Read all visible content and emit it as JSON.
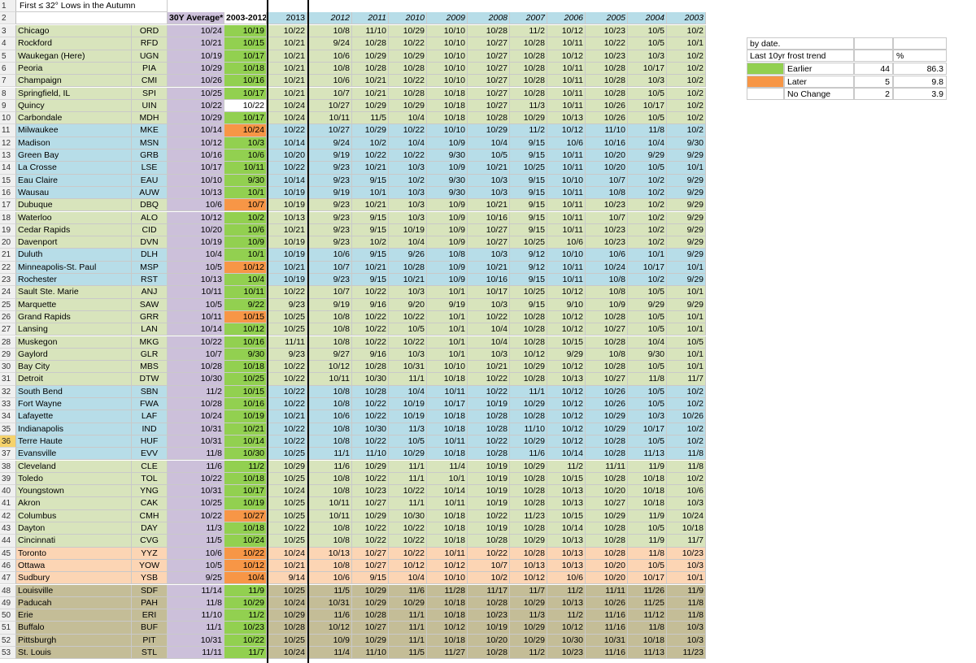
{
  "sheet_title": "First ≤ 32° Lows in the Autumn",
  "headers": {
    "avg30": "30Y Average*",
    "avg10": "2003-2012",
    "years": [
      "2013",
      "2012",
      "2011",
      "2010",
      "2009",
      "2008",
      "2007",
      "2006",
      "2005",
      "2004",
      "2003"
    ]
  },
  "colors": {
    "group_green": "#d8e4bc",
    "group_blue": "#b7dde8",
    "group_peach": "#fcd5b4",
    "group_tan": "#c4bd97",
    "avg30_purple": "#ccc0da",
    "earlier_green": "#92d050",
    "later_orange": "#f79646",
    "header_blue": "#b7dde8"
  },
  "legend": {
    "by_date": "by date.",
    "trend_label": "Last 10yr frost trend",
    "pct_header": "%",
    "rows": [
      {
        "label": "Earlier",
        "count": "44",
        "pct": "86.3",
        "color": "#92d050"
      },
      {
        "label": "Later",
        "count": "5",
        "pct": "9.8",
        "color": "#f79646"
      },
      {
        "label": "No Change",
        "count": "2",
        "pct": "3.9",
        "color": "#ffffff"
      }
    ]
  },
  "rows": [
    {
      "n": "3",
      "city": "Chicago",
      "code": "ORD",
      "a30": "10/24",
      "a10": "10/19",
      "t": "e",
      "y": [
        "10/22",
        "10/8",
        "11/10",
        "10/29",
        "10/10",
        "10/28",
        "11/2",
        "10/12",
        "10/23",
        "10/5",
        "10/2"
      ],
      "g": "green"
    },
    {
      "n": "4",
      "city": "Rockford",
      "code": "RFD",
      "a30": "10/21",
      "a10": "10/15",
      "t": "e",
      "y": [
        "10/21",
        "9/24",
        "10/28",
        "10/22",
        "10/10",
        "10/27",
        "10/28",
        "10/11",
        "10/22",
        "10/5",
        "10/1"
      ],
      "g": "green"
    },
    {
      "n": "5",
      "city": "Waukegan (Here)",
      "code": "UGN",
      "a30": "10/19",
      "a10": "10/17",
      "t": "e",
      "y": [
        "10/21",
        "10/6",
        "10/29",
        "10/29",
        "10/10",
        "10/27",
        "10/28",
        "10/12",
        "10/23",
        "10/3",
        "10/2"
      ],
      "g": "green"
    },
    {
      "n": "6",
      "city": "Peoria",
      "code": "PIA",
      "a30": "10/29",
      "a10": "10/18",
      "t": "e",
      "y": [
        "10/21",
        "10/8",
        "10/28",
        "10/28",
        "10/10",
        "10/27",
        "10/28",
        "10/11",
        "10/28",
        "10/17",
        "10/2"
      ],
      "g": "green"
    },
    {
      "n": "7",
      "city": "Champaign",
      "code": "CMI",
      "a30": "10/26",
      "a10": "10/16",
      "t": "e",
      "y": [
        "10/21",
        "10/6",
        "10/21",
        "10/22",
        "10/10",
        "10/27",
        "10/28",
        "10/11",
        "10/28",
        "10/3",
        "10/2"
      ],
      "g": "green"
    },
    {
      "n": "8",
      "city": "Springfield, IL",
      "code": "SPI",
      "a30": "10/25",
      "a10": "10/17",
      "t": "e",
      "y": [
        "10/21",
        "10/7",
        "10/21",
        "10/28",
        "10/18",
        "10/27",
        "10/28",
        "10/11",
        "10/28",
        "10/5",
        "10/2"
      ],
      "g": "green"
    },
    {
      "n": "9",
      "city": "Quincy",
      "code": "UIN",
      "a30": "10/22",
      "a10": "10/22",
      "t": "n",
      "y": [
        "10/24",
        "10/27",
        "10/29",
        "10/29",
        "10/18",
        "10/27",
        "11/3",
        "10/11",
        "10/26",
        "10/17",
        "10/2"
      ],
      "g": "green"
    },
    {
      "n": "10",
      "city": "Carbondale",
      "code": "MDH",
      "a30": "10/29",
      "a10": "10/17",
      "t": "e",
      "y": [
        "10/24",
        "10/11",
        "11/5",
        "10/4",
        "10/18",
        "10/28",
        "10/29",
        "10/13",
        "10/26",
        "10/5",
        "10/2"
      ],
      "g": "green"
    },
    {
      "n": "11",
      "city": "Milwaukee",
      "code": "MKE",
      "a30": "10/14",
      "a10": "10/24",
      "t": "l",
      "y": [
        "10/22",
        "10/27",
        "10/29",
        "10/22",
        "10/10",
        "10/29",
        "11/2",
        "10/12",
        "11/10",
        "11/8",
        "10/2"
      ],
      "g": "blue"
    },
    {
      "n": "12",
      "city": "Madison",
      "code": "MSN",
      "a30": "10/12",
      "a10": "10/3",
      "t": "e",
      "y": [
        "10/14",
        "9/24",
        "10/2",
        "10/4",
        "10/9",
        "10/4",
        "9/15",
        "10/6",
        "10/16",
        "10/4",
        "9/30"
      ],
      "g": "blue"
    },
    {
      "n": "13",
      "city": "Green Bay",
      "code": "GRB",
      "a30": "10/16",
      "a10": "10/6",
      "t": "e",
      "y": [
        "10/20",
        "9/19",
        "10/22",
        "10/22",
        "9/30",
        "10/5",
        "9/15",
        "10/11",
        "10/20",
        "9/29",
        "9/29"
      ],
      "g": "blue"
    },
    {
      "n": "14",
      "city": "La Crosse",
      "code": "LSE",
      "a30": "10/17",
      "a10": "10/11",
      "t": "e",
      "y": [
        "10/22",
        "9/23",
        "10/21",
        "10/3",
        "10/9",
        "10/21",
        "10/25",
        "10/11",
        "10/20",
        "10/5",
        "10/1"
      ],
      "g": "blue"
    },
    {
      "n": "15",
      "city": "Eau Claire",
      "code": "EAU",
      "a30": "10/10",
      "a10": "9/30",
      "t": "e",
      "y": [
        "10/14",
        "9/23",
        "9/15",
        "10/2",
        "9/30",
        "10/3",
        "9/15",
        "10/10",
        "10/7",
        "10/2",
        "9/29"
      ],
      "g": "blue"
    },
    {
      "n": "16",
      "city": "Wausau",
      "code": "AUW",
      "a30": "10/13",
      "a10": "10/1",
      "t": "e",
      "y": [
        "10/19",
        "9/19",
        "10/1",
        "10/3",
        "9/30",
        "10/3",
        "9/15",
        "10/11",
        "10/8",
        "10/2",
        "9/29"
      ],
      "g": "blue"
    },
    {
      "n": "17",
      "city": "Dubuque",
      "code": "DBQ",
      "a30": "10/6",
      "a10": "10/7",
      "t": "l",
      "y": [
        "10/19",
        "9/23",
        "10/21",
        "10/3",
        "10/9",
        "10/21",
        "9/15",
        "10/11",
        "10/23",
        "10/2",
        "9/29"
      ],
      "g": "green"
    },
    {
      "n": "18",
      "city": "Waterloo",
      "code": "ALO",
      "a30": "10/12",
      "a10": "10/2",
      "t": "e",
      "y": [
        "10/13",
        "9/23",
        "9/15",
        "10/3",
        "10/9",
        "10/16",
        "9/15",
        "10/11",
        "10/7",
        "10/2",
        "9/29"
      ],
      "g": "green"
    },
    {
      "n": "19",
      "city": "Cedar Rapids",
      "code": "CID",
      "a30": "10/20",
      "a10": "10/6",
      "t": "e",
      "y": [
        "10/21",
        "9/23",
        "9/15",
        "10/19",
        "10/9",
        "10/27",
        "9/15",
        "10/11",
        "10/23",
        "10/2",
        "9/29"
      ],
      "g": "green"
    },
    {
      "n": "20",
      "city": "Davenport",
      "code": "DVN",
      "a30": "10/19",
      "a10": "10/9",
      "t": "e",
      "y": [
        "10/19",
        "9/23",
        "10/2",
        "10/4",
        "10/9",
        "10/27",
        "10/25",
        "10/6",
        "10/23",
        "10/2",
        "9/29"
      ],
      "g": "green"
    },
    {
      "n": "21",
      "city": "Duluth",
      "code": "DLH",
      "a30": "10/4",
      "a10": "10/1",
      "t": "e",
      "y": [
        "10/19",
        "10/6",
        "9/15",
        "9/26",
        "10/8",
        "10/3",
        "9/12",
        "10/10",
        "10/6",
        "10/1",
        "9/29"
      ],
      "g": "blue"
    },
    {
      "n": "22",
      "city": "Minneapolis-St. Paul",
      "code": "MSP",
      "a30": "10/5",
      "a10": "10/12",
      "t": "l",
      "y": [
        "10/21",
        "10/7",
        "10/21",
        "10/28",
        "10/9",
        "10/21",
        "9/12",
        "10/11",
        "10/24",
        "10/17",
        "10/1"
      ],
      "g": "blue"
    },
    {
      "n": "23",
      "city": "Rochester",
      "code": "RST",
      "a30": "10/13",
      "a10": "10/4",
      "t": "e",
      "y": [
        "10/19",
        "9/23",
        "9/15",
        "10/21",
        "10/9",
        "10/16",
        "9/15",
        "10/11",
        "10/8",
        "10/2",
        "9/29"
      ],
      "g": "blue"
    },
    {
      "n": "24",
      "city": "Sault Ste. Marie",
      "code": "ANJ",
      "a30": "10/11",
      "a10": "10/11",
      "t": "e",
      "y": [
        "10/22",
        "10/7",
        "10/22",
        "10/3",
        "10/1",
        "10/17",
        "10/25",
        "10/12",
        "10/8",
        "10/5",
        "10/1"
      ],
      "g": "green"
    },
    {
      "n": "25",
      "city": "Marquette",
      "code": "SAW",
      "a30": "10/5",
      "a10": "9/22",
      "t": "e",
      "y": [
        "9/23",
        "9/19",
        "9/16",
        "9/20",
        "9/19",
        "10/3",
        "9/15",
        "9/10",
        "10/9",
        "9/29",
        "9/29"
      ],
      "g": "green"
    },
    {
      "n": "26",
      "city": "Grand Rapids",
      "code": "GRR",
      "a30": "10/11",
      "a10": "10/15",
      "t": "l",
      "y": [
        "10/25",
        "10/8",
        "10/22",
        "10/22",
        "10/1",
        "10/22",
        "10/28",
        "10/12",
        "10/28",
        "10/5",
        "10/1"
      ],
      "g": "green"
    },
    {
      "n": "27",
      "city": "Lansing",
      "code": "LAN",
      "a30": "10/14",
      "a10": "10/12",
      "t": "e",
      "y": [
        "10/25",
        "10/8",
        "10/22",
        "10/5",
        "10/1",
        "10/4",
        "10/28",
        "10/12",
        "10/27",
        "10/5",
        "10/1"
      ],
      "g": "green"
    },
    {
      "n": "28",
      "city": "Muskegon",
      "code": "MKG",
      "a30": "10/22",
      "a10": "10/16",
      "t": "e",
      "y": [
        "11/11",
        "10/8",
        "10/22",
        "10/22",
        "10/1",
        "10/4",
        "10/28",
        "10/15",
        "10/28",
        "10/4",
        "10/5"
      ],
      "g": "green"
    },
    {
      "n": "29",
      "city": "Gaylord",
      "code": "GLR",
      "a30": "10/7",
      "a10": "9/30",
      "t": "e",
      "y": [
        "9/23",
        "9/27",
        "9/16",
        "10/3",
        "10/1",
        "10/3",
        "10/12",
        "9/29",
        "10/8",
        "9/30",
        "10/1"
      ],
      "g": "green"
    },
    {
      "n": "30",
      "city": "Bay City",
      "code": "MBS",
      "a30": "10/28",
      "a10": "10/18",
      "t": "e",
      "y": [
        "10/22",
        "10/12",
        "10/28",
        "10/31",
        "10/10",
        "10/21",
        "10/29",
        "10/12",
        "10/28",
        "10/5",
        "10/1"
      ],
      "g": "green"
    },
    {
      "n": "31",
      "city": "Detroit",
      "code": "DTW",
      "a30": "10/30",
      "a10": "10/25",
      "t": "e",
      "y": [
        "10/22",
        "10/11",
        "10/30",
        "11/1",
        "10/18",
        "10/22",
        "10/28",
        "10/13",
        "10/27",
        "11/8",
        "11/7"
      ],
      "g": "green"
    },
    {
      "n": "32",
      "city": "South Bend",
      "code": "SBN",
      "a30": "11/2",
      "a10": "10/15",
      "t": "e",
      "y": [
        "10/22",
        "10/8",
        "10/28",
        "10/4",
        "10/11",
        "10/22",
        "11/1",
        "10/12",
        "10/26",
        "10/5",
        "10/2"
      ],
      "g": "blue"
    },
    {
      "n": "33",
      "city": "Fort Wayne",
      "code": "FWA",
      "a30": "10/28",
      "a10": "10/16",
      "t": "e",
      "y": [
        "10/22",
        "10/8",
        "10/22",
        "10/19",
        "10/17",
        "10/19",
        "10/29",
        "10/12",
        "10/26",
        "10/5",
        "10/2"
      ],
      "g": "blue"
    },
    {
      "n": "34",
      "city": "Lafayette",
      "code": "LAF",
      "a30": "10/24",
      "a10": "10/19",
      "t": "e",
      "y": [
        "10/21",
        "10/6",
        "10/22",
        "10/19",
        "10/18",
        "10/28",
        "10/28",
        "10/12",
        "10/29",
        "10/3",
        "10/26"
      ],
      "g": "blue"
    },
    {
      "n": "35",
      "city": "Indianapolis",
      "code": "IND",
      "a30": "10/31",
      "a10": "10/21",
      "t": "e",
      "y": [
        "10/22",
        "10/8",
        "10/30",
        "11/3",
        "10/18",
        "10/28",
        "11/10",
        "10/12",
        "10/29",
        "10/17",
        "10/2"
      ],
      "g": "blue"
    },
    {
      "n": "36",
      "city": "Terre Haute",
      "code": "HUF",
      "a30": "10/31",
      "a10": "10/14",
      "t": "e",
      "y": [
        "10/22",
        "10/8",
        "10/22",
        "10/5",
        "10/11",
        "10/22",
        "10/29",
        "10/12",
        "10/28",
        "10/5",
        "10/2"
      ],
      "g": "blue",
      "sel": true
    },
    {
      "n": "37",
      "city": "Evansville",
      "code": "EVV",
      "a30": "11/8",
      "a10": "10/30",
      "t": "e",
      "y": [
        "10/25",
        "11/1",
        "11/10",
        "10/29",
        "10/18",
        "10/28",
        "11/6",
        "10/14",
        "10/28",
        "11/13",
        "11/8"
      ],
      "g": "blue"
    },
    {
      "n": "38",
      "city": "Cleveland",
      "code": "CLE",
      "a30": "11/6",
      "a10": "11/2",
      "t": "e",
      "y": [
        "10/29",
        "11/6",
        "10/29",
        "11/1",
        "11/4",
        "10/19",
        "10/29",
        "11/2",
        "11/11",
        "11/9",
        "11/8"
      ],
      "g": "green"
    },
    {
      "n": "39",
      "city": "Toledo",
      "code": "TOL",
      "a30": "10/22",
      "a10": "10/18",
      "t": "e",
      "y": [
        "10/25",
        "10/8",
        "10/22",
        "11/1",
        "10/1",
        "10/19",
        "10/28",
        "10/15",
        "10/28",
        "10/18",
        "10/2"
      ],
      "g": "green"
    },
    {
      "n": "40",
      "city": "Youngstown",
      "code": "YNG",
      "a30": "10/31",
      "a10": "10/17",
      "t": "e",
      "y": [
        "10/24",
        "10/8",
        "10/23",
        "10/22",
        "10/14",
        "10/19",
        "10/28",
        "10/13",
        "10/20",
        "10/18",
        "10/6"
      ],
      "g": "green"
    },
    {
      "n": "41",
      "city": "Akron",
      "code": "CAK",
      "a30": "10/25",
      "a10": "10/19",
      "t": "e",
      "y": [
        "10/25",
        "10/11",
        "10/27",
        "11/1",
        "10/11",
        "10/19",
        "10/28",
        "10/13",
        "10/27",
        "10/18",
        "10/3"
      ],
      "g": "green"
    },
    {
      "n": "42",
      "city": "Columbus",
      "code": "CMH",
      "a30": "10/22",
      "a10": "10/27",
      "t": "l",
      "y": [
        "10/25",
        "10/11",
        "10/29",
        "10/30",
        "10/18",
        "10/22",
        "11/23",
        "10/15",
        "10/29",
        "11/9",
        "10/24"
      ],
      "g": "green"
    },
    {
      "n": "43",
      "city": "Dayton",
      "code": "DAY",
      "a30": "11/3",
      "a10": "10/18",
      "t": "e",
      "y": [
        "10/22",
        "10/8",
        "10/22",
        "10/22",
        "10/18",
        "10/19",
        "10/28",
        "10/14",
        "10/28",
        "10/5",
        "10/18"
      ],
      "g": "green"
    },
    {
      "n": "44",
      "city": "Cincinnati",
      "code": "CVG",
      "a30": "11/5",
      "a10": "10/24",
      "t": "e",
      "y": [
        "10/25",
        "10/8",
        "10/22",
        "10/22",
        "10/18",
        "10/28",
        "10/29",
        "10/13",
        "10/28",
        "11/9",
        "11/7"
      ],
      "g": "green"
    },
    {
      "n": "45",
      "city": "Toronto",
      "code": "YYZ",
      "a30": "10/6",
      "a10": "10/22",
      "t": "l",
      "y": [
        "10/24",
        "10/13",
        "10/27",
        "10/22",
        "10/11",
        "10/22",
        "10/28",
        "10/13",
        "10/28",
        "11/8",
        "10/23"
      ],
      "g": "peach"
    },
    {
      "n": "46",
      "city": "Ottawa",
      "code": "YOW",
      "a30": "10/5",
      "a10": "10/12",
      "t": "l",
      "y": [
        "10/21",
        "10/8",
        "10/27",
        "10/12",
        "10/12",
        "10/7",
        "10/13",
        "10/13",
        "10/20",
        "10/5",
        "10/3"
      ],
      "g": "peach"
    },
    {
      "n": "47",
      "city": "Sudbury",
      "code": "YSB",
      "a30": "9/25",
      "a10": "10/4",
      "t": "l",
      "y": [
        "9/14",
        "10/6",
        "9/15",
        "10/4",
        "10/10",
        "10/2",
        "10/12",
        "10/6",
        "10/20",
        "10/17",
        "10/1"
      ],
      "g": "peach"
    },
    {
      "n": "48",
      "city": "Louisville",
      "code": "SDF",
      "a30": "11/14",
      "a10": "11/9",
      "t": "e",
      "y": [
        "10/25",
        "11/5",
        "10/29",
        "11/6",
        "11/28",
        "11/17",
        "11/7",
        "11/2",
        "11/11",
        "11/26",
        "11/9"
      ],
      "g": "tan"
    },
    {
      "n": "49",
      "city": "Paducah",
      "code": "PAH",
      "a30": "11/8",
      "a10": "10/29",
      "t": "e",
      "y": [
        "10/24",
        "10/31",
        "10/29",
        "10/29",
        "10/18",
        "10/28",
        "10/29",
        "10/13",
        "10/26",
        "11/25",
        "11/8"
      ],
      "g": "tan"
    },
    {
      "n": "50",
      "city": "Erie",
      "code": "ERI",
      "a30": "11/10",
      "a10": "11/2",
      "t": "e",
      "y": [
        "10/29",
        "11/6",
        "10/28",
        "11/1",
        "10/18",
        "10/23",
        "11/3",
        "11/2",
        "11/16",
        "11/12",
        "11/8"
      ],
      "g": "tan"
    },
    {
      "n": "51",
      "city": "Buffalo",
      "code": "BUF",
      "a30": "11/1",
      "a10": "10/23",
      "t": "e",
      "y": [
        "10/28",
        "10/12",
        "10/27",
        "11/1",
        "10/12",
        "10/19",
        "10/29",
        "10/12",
        "11/16",
        "11/8",
        "10/3"
      ],
      "g": "tan"
    },
    {
      "n": "52",
      "city": "Pittsburgh",
      "code": "PIT",
      "a30": "10/31",
      "a10": "10/22",
      "t": "e",
      "y": [
        "10/25",
        "10/9",
        "10/29",
        "11/1",
        "10/18",
        "10/20",
        "10/29",
        "10/30",
        "10/31",
        "10/18",
        "10/3"
      ],
      "g": "tan"
    },
    {
      "n": "53",
      "city": "St. Louis",
      "code": "STL",
      "a30": "11/11",
      "a10": "11/7",
      "t": "e",
      "y": [
        "10/24",
        "11/4",
        "11/10",
        "11/5",
        "11/27",
        "10/28",
        "11/2",
        "10/23",
        "11/16",
        "11/13",
        "11/23"
      ],
      "g": "tan"
    }
  ]
}
